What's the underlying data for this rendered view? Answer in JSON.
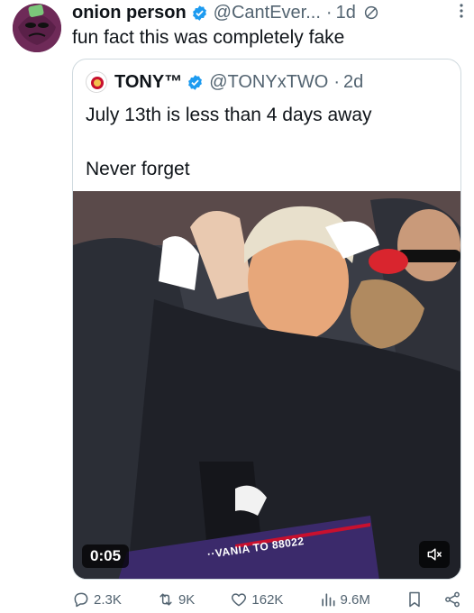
{
  "tweet": {
    "author_name": "onion person",
    "author_handle": "@CantEver...",
    "separator": "·",
    "time": "1d",
    "text": "fun fact this was completely fake"
  },
  "quoted": {
    "author_name": "TONY™",
    "author_handle": "@TONYxTWO",
    "separator": "·",
    "time": "2d",
    "line1": "July 13th is less than 4 days away",
    "line2": "Never forget",
    "video": {
      "timestamp": "0:05",
      "banner_text": "··VANIA TO 88022"
    }
  },
  "actions": {
    "replies": "2.3K",
    "reposts": "9K",
    "likes": "162K",
    "views": "9.6M"
  },
  "icons": [
    "verified-badge-icon",
    "no-reply-icon",
    "more-icon",
    "reply-icon",
    "repost-icon",
    "like-icon",
    "views-icon",
    "bookmark-icon",
    "share-icon",
    "mute-icon"
  ],
  "colors": {
    "verified": "#1d9bf0",
    "text": "#0f1419",
    "secondary": "#536471",
    "border": "#cfd9de",
    "avatar_bg": "#6e2a58"
  }
}
